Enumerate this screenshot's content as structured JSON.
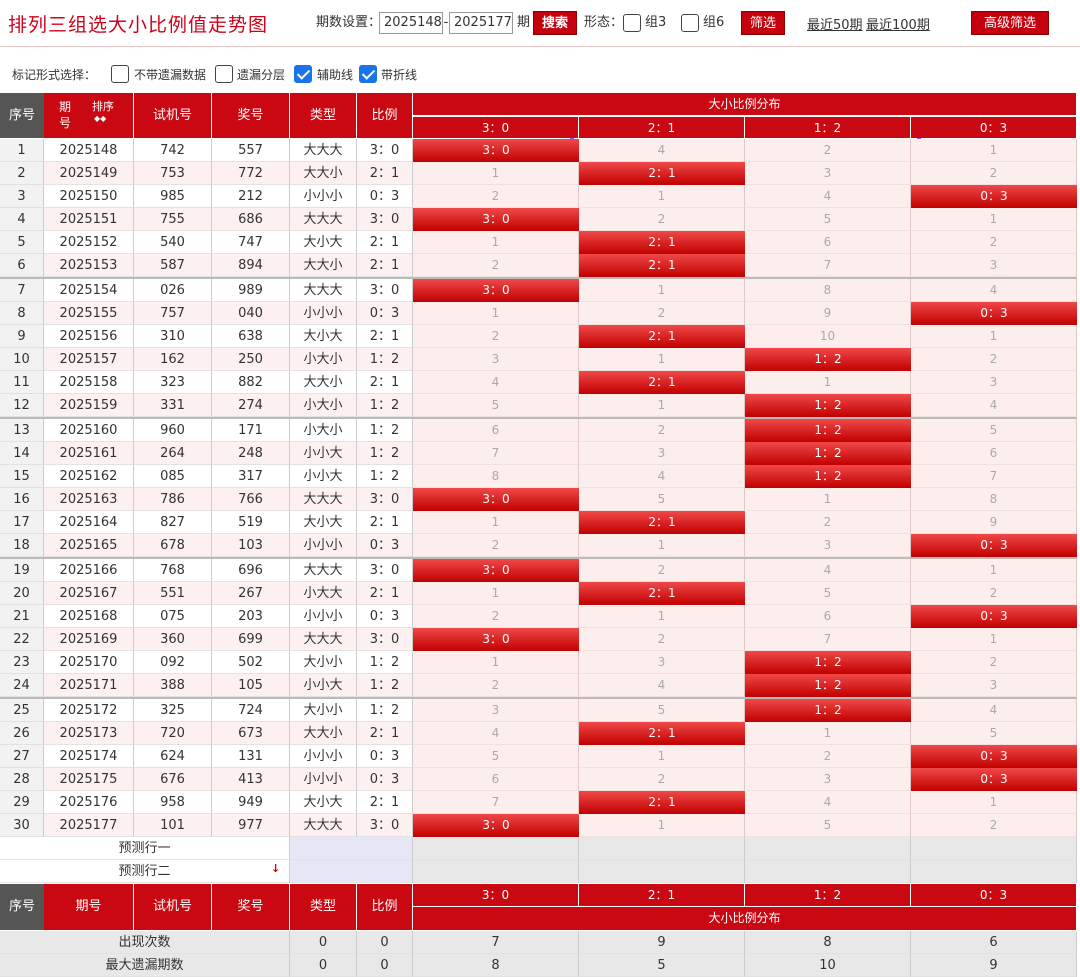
{
  "page": {
    "title": "排列三组选大小比例值走势图"
  },
  "toolbar": {
    "period_label": "期数设置：",
    "from_value": "2025148",
    "dash": "-",
    "to_value": "2025177",
    "period_unit": "期",
    "search_label": "搜索",
    "shape_label": "形态：",
    "group3_label": "组3",
    "group6_label": "组6",
    "filter_label": "筛选",
    "recent50_label": "最近50期",
    "recent100_label": "最近100期",
    "advanced_label": "高级筛选"
  },
  "options": {
    "label": "标记形式选择：",
    "items": [
      {
        "label": "不带遗漏数据",
        "checked": false
      },
      {
        "label": "遗漏分层",
        "checked": false
      },
      {
        "label": "辅助线",
        "checked": true
      },
      {
        "label": "带折线",
        "checked": true
      }
    ]
  },
  "table": {
    "headers": {
      "seq": "序号",
      "period": "期号",
      "sort": "排序",
      "test": "试机号",
      "prize": "奖号",
      "type": "类型",
      "ratio": "比例",
      "dist": "大小比例分布"
    },
    "dist_cols": [
      "3：0",
      "2：1",
      "1：2",
      "0：3"
    ],
    "rows": [
      {
        "seq": "1",
        "period": "2025148",
        "test": "742",
        "prize": "557",
        "type": "大大大",
        "ratio": "3：0",
        "cells": [
          "3：0",
          "4",
          "2",
          "1"
        ],
        "hit": 0
      },
      {
        "seq": "2",
        "period": "2025149",
        "test": "753",
        "prize": "772",
        "type": "大大小",
        "ratio": "2：1",
        "cells": [
          "1",
          "2：1",
          "3",
          "2"
        ],
        "hit": 1
      },
      {
        "seq": "3",
        "period": "2025150",
        "test": "985",
        "prize": "212",
        "type": "小小小",
        "ratio": "0：3",
        "cells": [
          "2",
          "1",
          "4",
          "0：3"
        ],
        "hit": 3
      },
      {
        "seq": "4",
        "period": "2025151",
        "test": "755",
        "prize": "686",
        "type": "大大大",
        "ratio": "3：0",
        "cells": [
          "3：0",
          "2",
          "5",
          "1"
        ],
        "hit": 0
      },
      {
        "seq": "5",
        "period": "2025152",
        "test": "540",
        "prize": "747",
        "type": "大小大",
        "ratio": "2：1",
        "cells": [
          "1",
          "2：1",
          "6",
          "2"
        ],
        "hit": 1
      },
      {
        "seq": "6",
        "period": "2025153",
        "test": "587",
        "prize": "894",
        "type": "大大小",
        "ratio": "2：1",
        "cells": [
          "2",
          "2：1",
          "7",
          "3"
        ],
        "hit": 1
      },
      {
        "seq": "7",
        "period": "2025154",
        "test": "026",
        "prize": "989",
        "type": "大大大",
        "ratio": "3：0",
        "cells": [
          "3：0",
          "1",
          "8",
          "4"
        ],
        "hit": 0
      },
      {
        "seq": "8",
        "period": "2025155",
        "test": "757",
        "prize": "040",
        "type": "小小小",
        "ratio": "0：3",
        "cells": [
          "1",
          "2",
          "9",
          "0：3"
        ],
        "hit": 3
      },
      {
        "seq": "9",
        "period": "2025156",
        "test": "310",
        "prize": "638",
        "type": "大小大",
        "ratio": "2：1",
        "cells": [
          "2",
          "2：1",
          "10",
          "1"
        ],
        "hit": 1
      },
      {
        "seq": "10",
        "period": "2025157",
        "test": "162",
        "prize": "250",
        "type": "小大小",
        "ratio": "1：2",
        "cells": [
          "3",
          "1",
          "1：2",
          "2"
        ],
        "hit": 2
      },
      {
        "seq": "11",
        "period": "2025158",
        "test": "323",
        "prize": "882",
        "type": "大大小",
        "ratio": "2：1",
        "cells": [
          "4",
          "2：1",
          "1",
          "3"
        ],
        "hit": 1
      },
      {
        "seq": "12",
        "period": "2025159",
        "test": "331",
        "prize": "274",
        "type": "小大小",
        "ratio": "1：2",
        "cells": [
          "5",
          "1",
          "1：2",
          "4"
        ],
        "hit": 2
      },
      {
        "seq": "13",
        "period": "2025160",
        "test": "960",
        "prize": "171",
        "type": "小大小",
        "ratio": "1：2",
        "cells": [
          "6",
          "2",
          "1：2",
          "5"
        ],
        "hit": 2
      },
      {
        "seq": "14",
        "period": "2025161",
        "test": "264",
        "prize": "248",
        "type": "小小大",
        "ratio": "1：2",
        "cells": [
          "7",
          "3",
          "1：2",
          "6"
        ],
        "hit": 2
      },
      {
        "seq": "15",
        "period": "2025162",
        "test": "085",
        "prize": "317",
        "type": "小小大",
        "ratio": "1：2",
        "cells": [
          "8",
          "4",
          "1：2",
          "7"
        ],
        "hit": 2
      },
      {
        "seq": "16",
        "period": "2025163",
        "test": "786",
        "prize": "766",
        "type": "大大大",
        "ratio": "3：0",
        "cells": [
          "3：0",
          "5",
          "1",
          "8"
        ],
        "hit": 0
      },
      {
        "seq": "17",
        "period": "2025164",
        "test": "827",
        "prize": "519",
        "type": "大小大",
        "ratio": "2：1",
        "cells": [
          "1",
          "2：1",
          "2",
          "9"
        ],
        "hit": 1
      },
      {
        "seq": "18",
        "period": "2025165",
        "test": "678",
        "prize": "103",
        "type": "小小小",
        "ratio": "0：3",
        "cells": [
          "2",
          "1",
          "3",
          "0：3"
        ],
        "hit": 3
      },
      {
        "seq": "19",
        "period": "2025166",
        "test": "768",
        "prize": "696",
        "type": "大大大",
        "ratio": "3：0",
        "cells": [
          "3：0",
          "2",
          "4",
          "1"
        ],
        "hit": 0
      },
      {
        "seq": "20",
        "period": "2025167",
        "test": "551",
        "prize": "267",
        "type": "小大大",
        "ratio": "2：1",
        "cells": [
          "1",
          "2：1",
          "5",
          "2"
        ],
        "hit": 1
      },
      {
        "seq": "21",
        "period": "2025168",
        "test": "075",
        "prize": "203",
        "type": "小小小",
        "ratio": "0：3",
        "cells": [
          "2",
          "1",
          "6",
          "0：3"
        ],
        "hit": 3
      },
      {
        "seq": "22",
        "period": "2025169",
        "test": "360",
        "prize": "699",
        "type": "大大大",
        "ratio": "3：0",
        "cells": [
          "3：0",
          "2",
          "7",
          "1"
        ],
        "hit": 0
      },
      {
        "seq": "23",
        "period": "2025170",
        "test": "092",
        "prize": "502",
        "type": "大小小",
        "ratio": "1：2",
        "cells": [
          "1",
          "3",
          "1：2",
          "2"
        ],
        "hit": 2
      },
      {
        "seq": "24",
        "period": "2025171",
        "test": "388",
        "prize": "105",
        "type": "小小大",
        "ratio": "1：2",
        "cells": [
          "2",
          "4",
          "1：2",
          "3"
        ],
        "hit": 2
      },
      {
        "seq": "25",
        "period": "2025172",
        "test": "325",
        "prize": "724",
        "type": "大小小",
        "ratio": "1：2",
        "cells": [
          "3",
          "5",
          "1：2",
          "4"
        ],
        "hit": 2
      },
      {
        "seq": "26",
        "period": "2025173",
        "test": "720",
        "prize": "673",
        "type": "大大小",
        "ratio": "2：1",
        "cells": [
          "4",
          "2：1",
          "1",
          "5"
        ],
        "hit": 1
      },
      {
        "seq": "27",
        "period": "2025174",
        "test": "624",
        "prize": "131",
        "type": "小小小",
        "ratio": "0：3",
        "cells": [
          "5",
          "1",
          "2",
          "0：3"
        ],
        "hit": 3
      },
      {
        "seq": "28",
        "period": "2025175",
        "test": "676",
        "prize": "413",
        "type": "小小小",
        "ratio": "0：3",
        "cells": [
          "6",
          "2",
          "3",
          "0：3"
        ],
        "hit": 3
      },
      {
        "seq": "29",
        "period": "2025176",
        "test": "958",
        "prize": "949",
        "type": "大小大",
        "ratio": "2：1",
        "cells": [
          "7",
          "2：1",
          "4",
          "1"
        ],
        "hit": 1
      },
      {
        "seq": "30",
        "period": "2025177",
        "test": "101",
        "prize": "977",
        "type": "大大大",
        "ratio": "3：0",
        "cells": [
          "3：0",
          "1",
          "5",
          "2"
        ],
        "hit": 0
      }
    ],
    "predict": [
      "预测行一",
      "预测行二"
    ],
    "footer_headers": {
      "seq": "序号",
      "period": "期号",
      "test": "试机号",
      "prize": "奖号",
      "type": "类型",
      "ratio": "比例",
      "dist": "大小比例分布"
    },
    "stats": [
      {
        "label": "出现次数",
        "type": "0",
        "ratio": "0",
        "vals": [
          "7",
          "9",
          "8",
          "6"
        ]
      },
      {
        "label": "最大遗漏期数",
        "type": "0",
        "ratio": "0",
        "vals": [
          "8",
          "5",
          "10",
          "9"
        ]
      }
    ]
  },
  "colors": {
    "accent": "#c90812",
    "highlight": "#9b4dff",
    "row_alt": "#fdeeee"
  }
}
